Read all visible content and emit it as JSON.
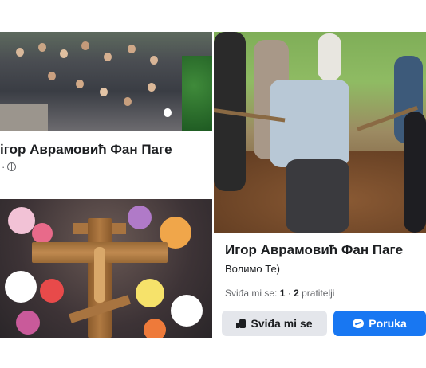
{
  "left_card": {
    "page_title": "ігор Аврамовић Фан Паге",
    "meta_dot": "· ",
    "globe_icon": "globe-icon"
  },
  "right_card": {
    "page_title": "Игор Аврамовић Фан Паге",
    "subtitle": "Волимо Те)",
    "stats": {
      "likes_label": "Sviđa mi se:",
      "likes_count": "1",
      "separator": "·",
      "followers_count": "2",
      "followers_label": "pratitelji"
    },
    "like_button": {
      "label": "Sviđa mi se",
      "icon": "thumbs-up-icon"
    },
    "message_button": {
      "label": "Poruka",
      "icon": "messenger-icon"
    }
  },
  "colors": {
    "primary_blue": "#1877f2",
    "secondary_button": "#e4e6eb",
    "text_primary": "#1c1e21",
    "text_secondary": "#65676b"
  }
}
